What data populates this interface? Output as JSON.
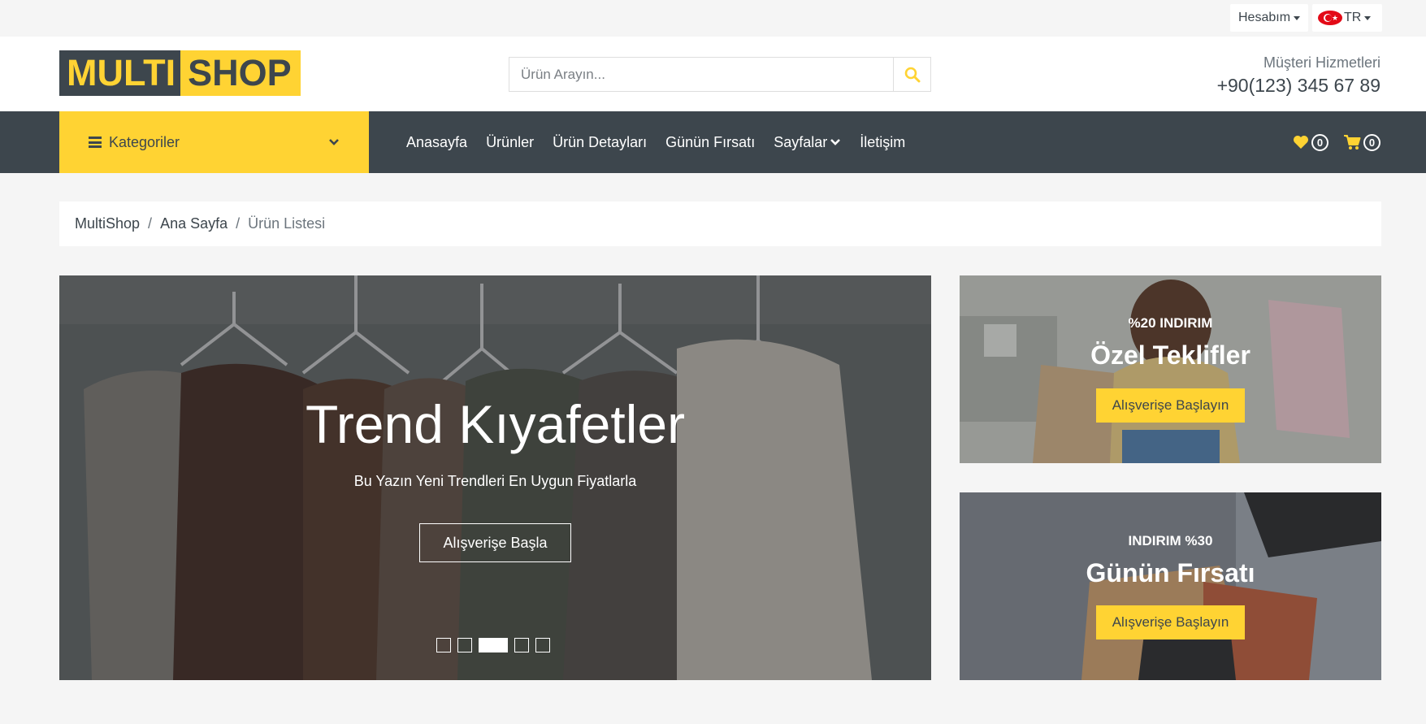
{
  "topbar": {
    "account_label": "Hesabım",
    "language_label": "TR"
  },
  "header": {
    "logo_part1": "MULTI",
    "logo_part2": "SHOP",
    "search_placeholder": "Ürün Arayın...",
    "customer_service_label": "Müşteri Hizmetleri",
    "phone": "+90(123) 345 67 89"
  },
  "nav": {
    "categories_label": "Kategoriler",
    "items": [
      {
        "label": "Anasayfa"
      },
      {
        "label": "Ürünler"
      },
      {
        "label": "Ürün Detayları"
      },
      {
        "label": "Günün Fırsatı"
      },
      {
        "label": "Sayfalar"
      },
      {
        "label": "İletişim"
      }
    ],
    "wishlist_count": "0",
    "cart_count": "0"
  },
  "breadcrumb": [
    "MultiShop",
    "Ana Sayfa",
    "Ürün Listesi"
  ],
  "hero": {
    "title": "Trend Kıyafetler",
    "subtitle": "Bu Yazın Yeni Trendleri En Uygun Fiyatlarla",
    "button": "Alışverişe Başla",
    "slide_count": 5,
    "active_slide": 3
  },
  "offers": [
    {
      "tag": "%20 INDIRIM",
      "title": "Özel Teklifler",
      "button": "Alışverişe Başlayın"
    },
    {
      "tag": "INDIRIM %30",
      "title": "Günün Fırsatı",
      "button": "Alışverişe Başlayın"
    }
  ],
  "colors": {
    "accent": "#ffd333",
    "dark": "#3d464d",
    "light": "#f5f5f5"
  }
}
